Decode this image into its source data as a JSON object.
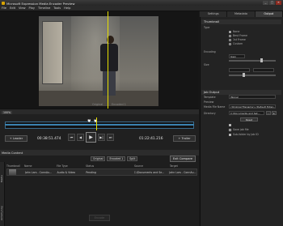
{
  "window": {
    "title": "Microsoft Expression Media Encoder Preview",
    "controls": [
      "_",
      "□",
      "✕"
    ]
  },
  "menu": [
    "File",
    "Edit",
    "View",
    "Play",
    "Timeline",
    "Tools",
    "Help"
  ],
  "video": {
    "label_original": "Original",
    "label_encoded": "Encoded 1"
  },
  "zoom": {
    "value": "100%"
  },
  "timeline": {
    "leader_label": "+ Leader",
    "trailer_label": "+ Trailer",
    "current_time": "00:38:51.474",
    "duration": "01:22:41.216",
    "transport": [
      "⏮",
      "◀",
      "▶",
      "▶|",
      "⏭"
    ]
  },
  "media": {
    "panel_title": "Media Content",
    "compare_left": "Original",
    "compare_right": "Encoded 1",
    "split_label": "Split",
    "exit_compare": "Exit Compare",
    "columns": [
      "Thumbnail",
      "Name",
      "File Type",
      "Status",
      "Source",
      "Target"
    ],
    "rows": [
      {
        "name": "John Lars - ConnAu...",
        "type": "Audio & Video",
        "status": "Pending",
        "source": "C:\\Documents and Se...",
        "target": "John Lars - ConnAu..."
      }
    ],
    "side_tabs": [
      "Media",
      "Activity Log"
    ],
    "encode_label": "Encode"
  },
  "right_panel": {
    "tabs": [
      "Settings",
      "Metadata",
      "Output"
    ],
    "active_tab": "Output",
    "thumbnail": {
      "header": "Thumbnail",
      "type_label": "Type",
      "options": [
        "None",
        "Best Frame",
        "1st Frame",
        "Custom"
      ],
      "selected": "None",
      "encoding_label": "Encoding",
      "encoding_value": "Jpeg",
      "size_label": "Size"
    },
    "job_output": {
      "header": "Job Output",
      "template_label": "Template",
      "template_value": "(None)",
      "preview_label": "Preview",
      "filename_label": "Media File Name",
      "filename_value": "{Original Filename}.{Default Exten...",
      "directory_label": "Directory",
      "directory_value": "C:\\Documents and Set...",
      "reset_label": "Reset",
      "save_job_label": "Save job file",
      "subfolder_label": "Sub-folder by Job ID"
    }
  }
}
